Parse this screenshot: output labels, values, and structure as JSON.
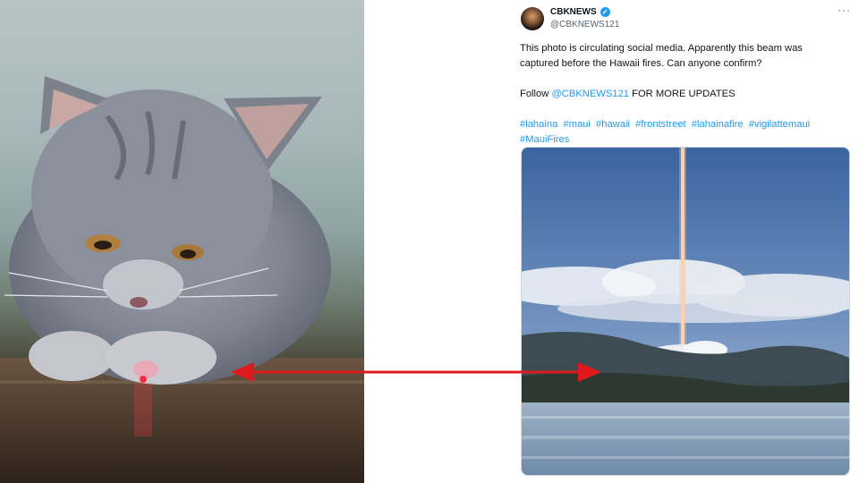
{
  "tweet": {
    "display_name": "CBKNEWS",
    "handle": "@CBKNEWS121",
    "verified_icon": "check-icon",
    "more_icon": "···",
    "text_line1": "This photo is circulating social media. Apparently this beam was",
    "text_line2": "captured before the Hawaii fires. Can anyone confirm?",
    "follow_prefix": "Follow ",
    "follow_link": "@CBKNEWS121",
    "follow_suffix": " FOR MORE UPDATES",
    "hashtags": [
      "#lahaina",
      "#maui",
      "#hawaii",
      "#frontstreet",
      "#lahainafire",
      "#vigilattemaui",
      "#MauiFires"
    ]
  },
  "colors": {
    "link": "#1d9bf0",
    "arrow": "#e0191c",
    "text": "#0f1419",
    "secondary": "#536471"
  }
}
